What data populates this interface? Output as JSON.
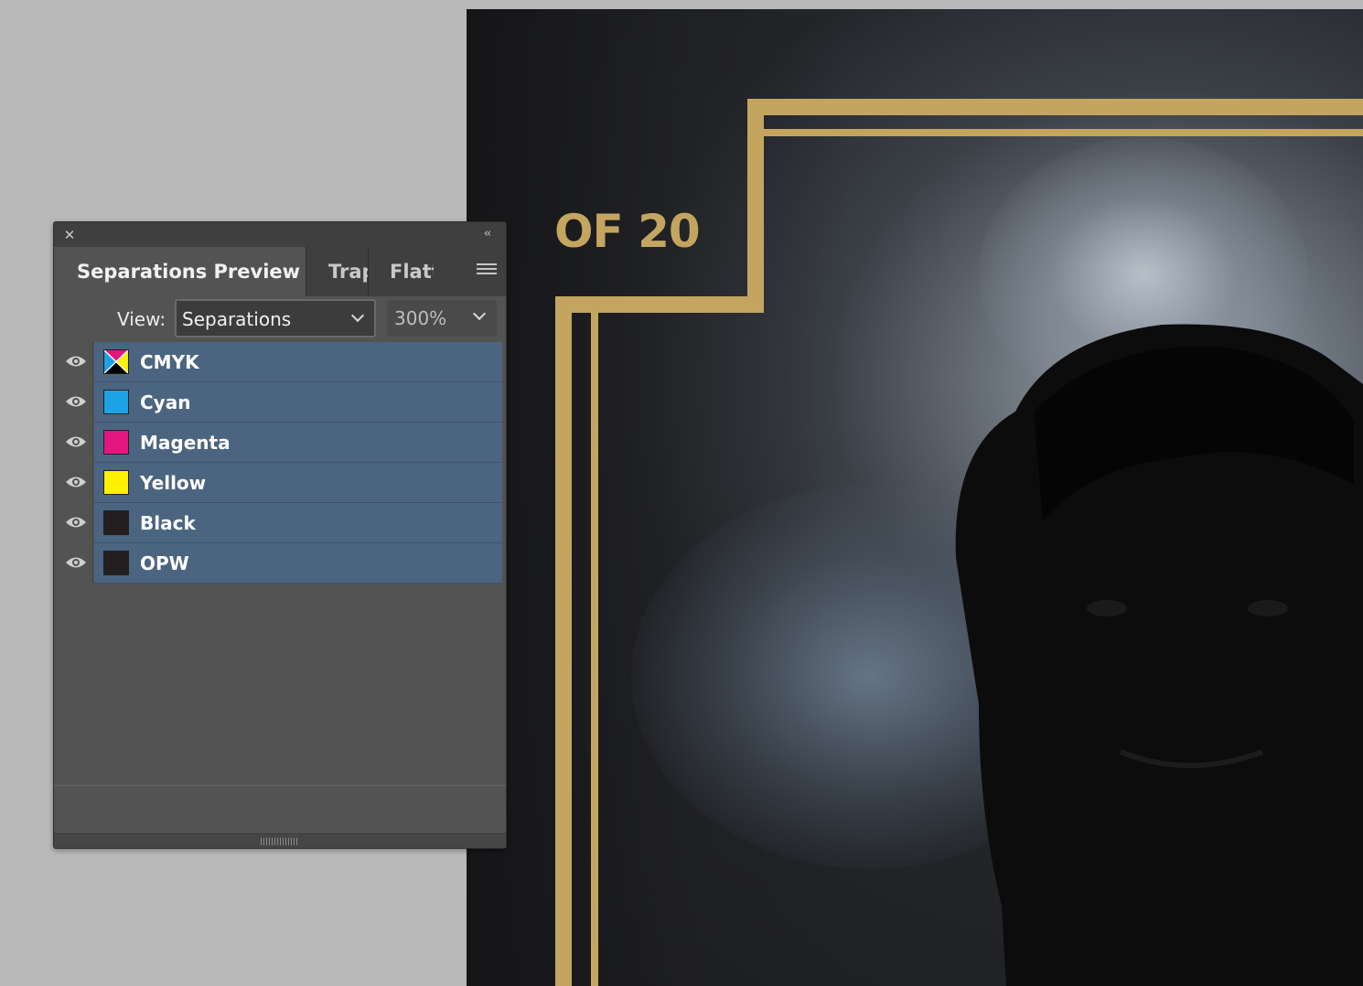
{
  "panel": {
    "tabs": [
      {
        "label": "Separations Preview",
        "active": true
      },
      {
        "label": "Trap Presets",
        "active": false
      },
      {
        "label": "Flattener Preview",
        "active": false
      }
    ],
    "view_label": "View:",
    "view_value": "Separations",
    "zoom_value": "300%",
    "inks": [
      {
        "name": "CMYK",
        "color": "cmyk-composite",
        "visible": true
      },
      {
        "name": "Cyan",
        "color": "#1ea2e6",
        "visible": true
      },
      {
        "name": "Magenta",
        "color": "#e4157f",
        "visible": true
      },
      {
        "name": "Yellow",
        "color": "#fff200",
        "visible": true
      },
      {
        "name": "Black",
        "color": "#231f20",
        "visible": true
      },
      {
        "name": "OPW",
        "color": "#231f20",
        "visible": true
      }
    ],
    "icons": {
      "close": "close-icon",
      "collapse": "double-chevron-left-icon",
      "menu": "hamburger-menu-icon",
      "visibility": "eye-icon"
    }
  },
  "document": {
    "headline": "OF 20",
    "accent_color": "#c4a560"
  }
}
